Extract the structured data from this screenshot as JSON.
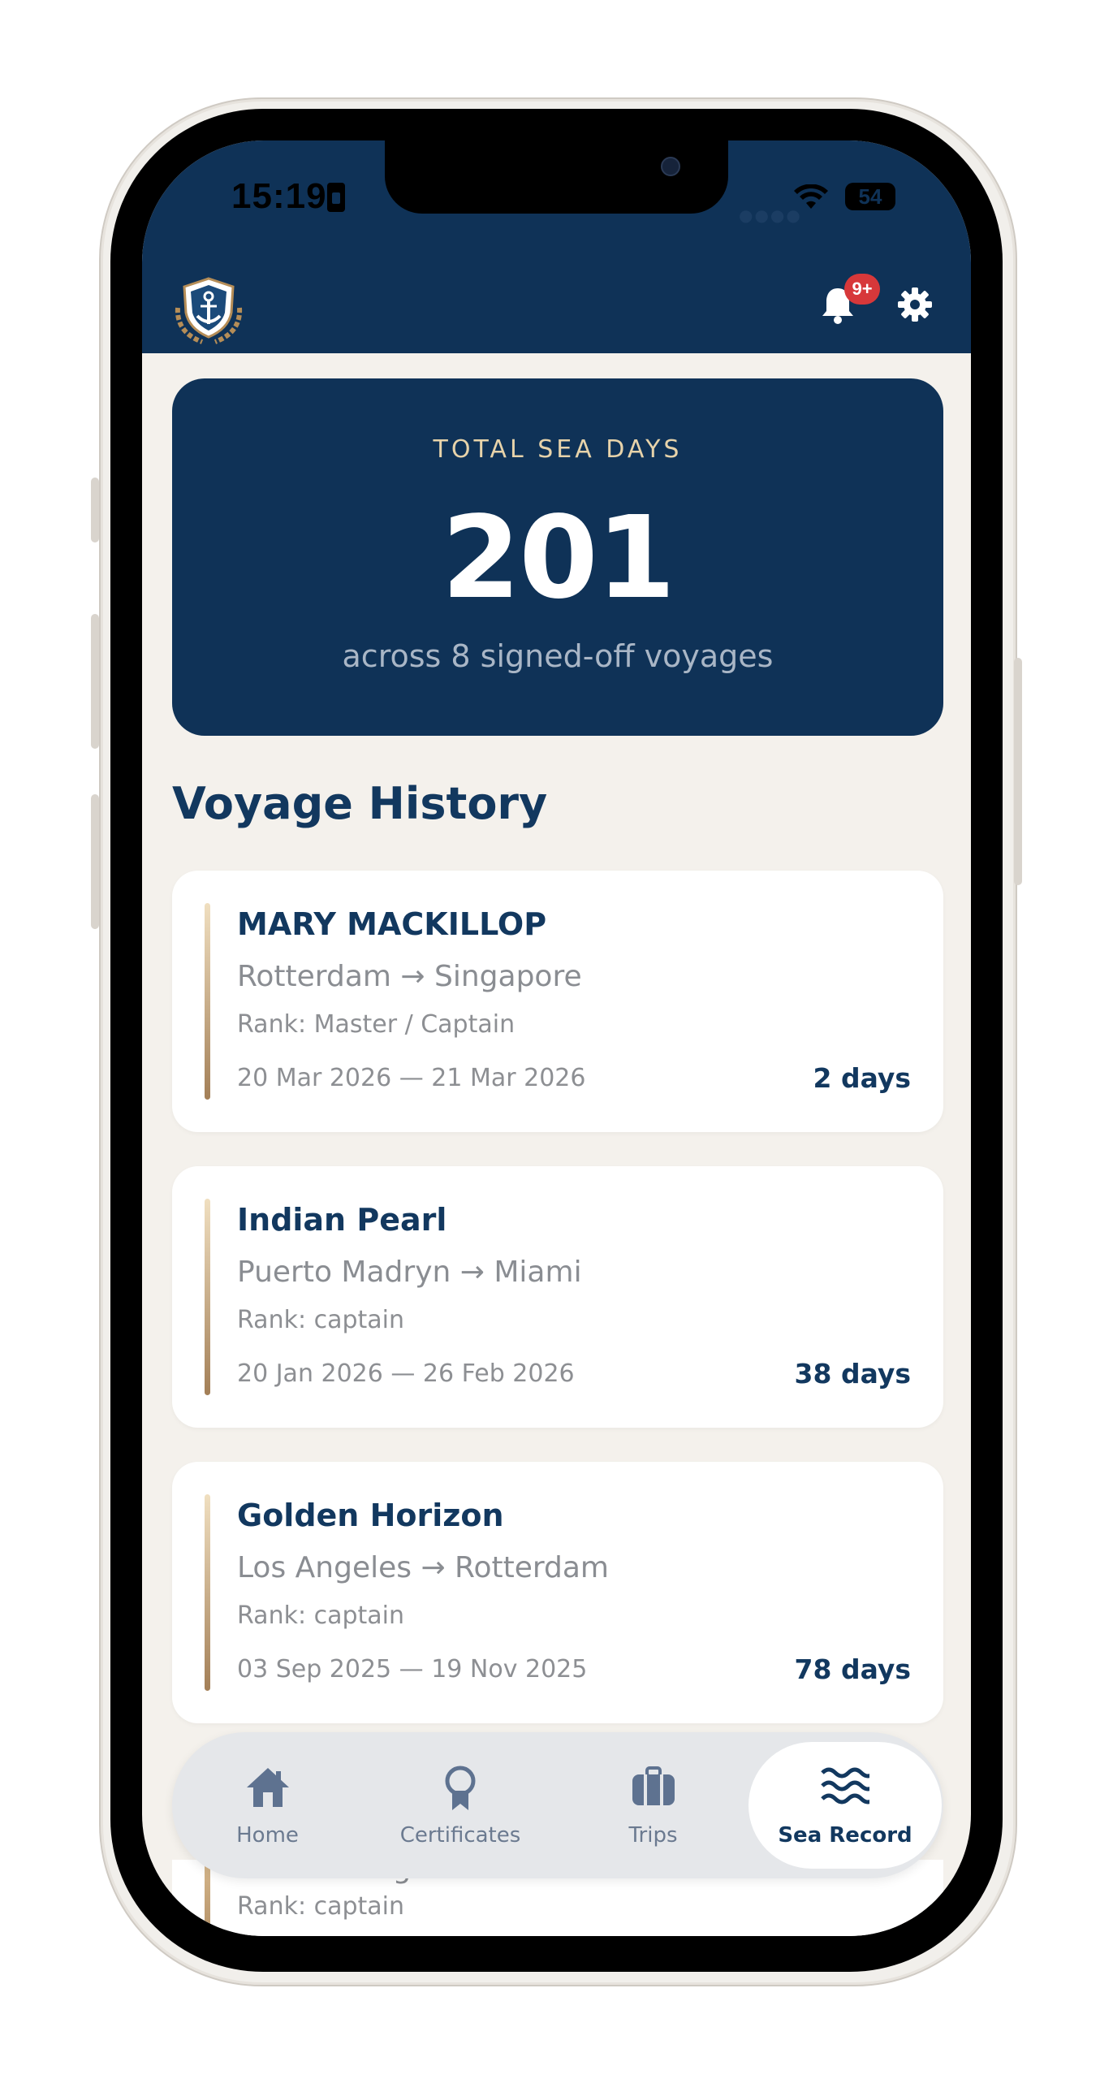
{
  "status_bar": {
    "time": "15:19",
    "battery": "54"
  },
  "header": {
    "notification_count": "9+"
  },
  "summary": {
    "label": "TOTAL SEA DAYS",
    "value": "201",
    "subtitle": "across 8 signed-off voyages"
  },
  "section": {
    "title": "Voyage History"
  },
  "voyages": [
    {
      "vessel": "MARY MACKILLOP",
      "route": "Rotterdam → Singapore",
      "rank": "Rank: Master / Captain",
      "dates": "20 Mar 2026 — 21 Mar 2026",
      "days": "2 days"
    },
    {
      "vessel": "Indian Pearl",
      "route": "Puerto Madryn → Miami",
      "rank": "Rank: captain",
      "dates": "20 Jan 2026 — 26 Feb 2026",
      "days": "38 days"
    },
    {
      "vessel": "Golden Horizon",
      "route": "Los Angeles → Rotterdam",
      "rank": "Rank: captain",
      "dates": "03 Sep 2025 — 19 Nov 2025",
      "days": "78 days"
    },
    {
      "route": "Gothenburg → Miami",
      "rank": "Rank: captain"
    }
  ],
  "tabs": [
    {
      "label": "Home",
      "icon": "home-icon"
    },
    {
      "label": "Certificates",
      "icon": "award-icon"
    },
    {
      "label": "Trips",
      "icon": "briefcase-icon"
    },
    {
      "label": "Sea Record",
      "icon": "waves-icon",
      "active": true
    }
  ],
  "colors": {
    "navy": "#0f3257",
    "accent_gold": "#e7d3aa",
    "background": "#f4f1ec",
    "badge": "#d7383a"
  }
}
